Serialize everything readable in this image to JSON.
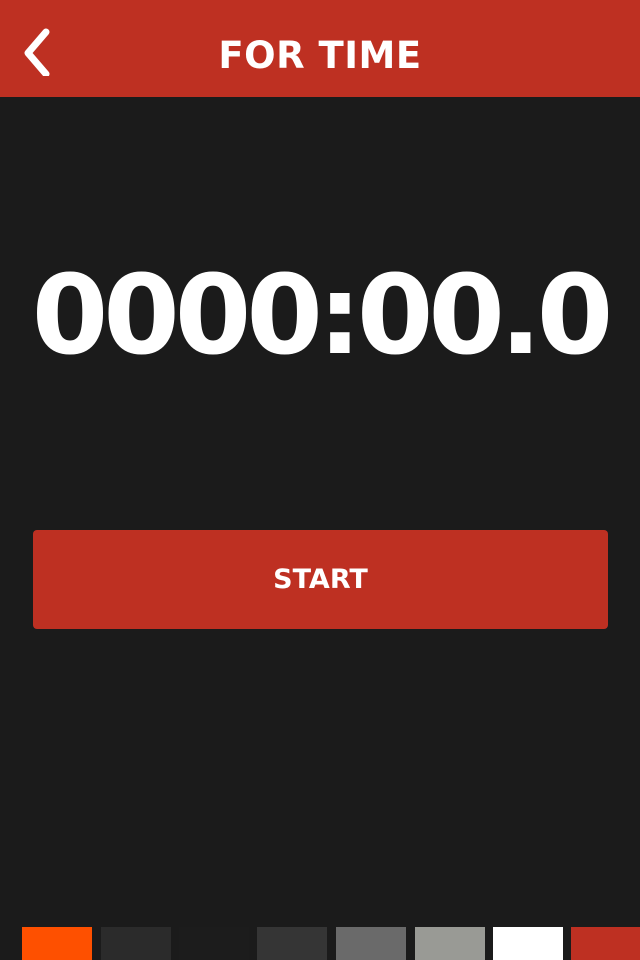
{
  "header": {
    "title": "FOR TIME",
    "back_icon": "chevron-left-icon",
    "background_color": "#be3022"
  },
  "timer": {
    "display": "0000:00.0"
  },
  "controls": {
    "start_label": "START",
    "button_color": "#be3022"
  },
  "swatches": [
    {
      "name": "orange",
      "color": "#fe5000"
    },
    {
      "name": "charcoal",
      "color": "#2b2b2b"
    },
    {
      "name": "black",
      "color": "#1c1c1c"
    },
    {
      "name": "dark-gray",
      "color": "#353535"
    },
    {
      "name": "gray",
      "color": "#6a6a6a"
    },
    {
      "name": "light-gray",
      "color": "#999a95"
    },
    {
      "name": "white",
      "color": "#ffffff"
    },
    {
      "name": "red",
      "color": "#be3022"
    }
  ],
  "theme": {
    "background": "#1b1b1b",
    "text": "#ffffff"
  }
}
